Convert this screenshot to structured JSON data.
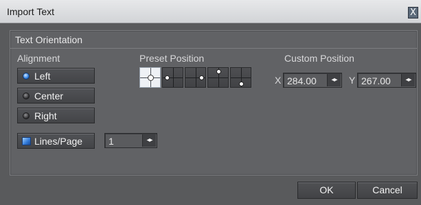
{
  "window": {
    "title": "Import Text",
    "close_label": "X"
  },
  "panel": {
    "title": "Text Orientation"
  },
  "alignment": {
    "label": "Alignment",
    "options": [
      {
        "label": "Left",
        "selected": true
      },
      {
        "label": "Center",
        "selected": false
      },
      {
        "label": "Right",
        "selected": false
      }
    ]
  },
  "lines_per_page": {
    "label": "Lines/Page",
    "checked": true,
    "value": "1",
    "spin_icon": "left-right-arrows"
  },
  "preset_position": {
    "label": "Preset Position",
    "presets": [
      "center",
      "left",
      "right",
      "top",
      "bottom"
    ],
    "selected": "center"
  },
  "custom_position": {
    "label": "Custom Position",
    "x_label": "X",
    "x_value": "284.00",
    "y_label": "Y",
    "y_value": "267.00"
  },
  "footer": {
    "ok_label": "OK",
    "cancel_label": "Cancel"
  },
  "colors": {
    "accent": "#2f7fe0",
    "background": "#595a5c",
    "panel": "#616265"
  }
}
